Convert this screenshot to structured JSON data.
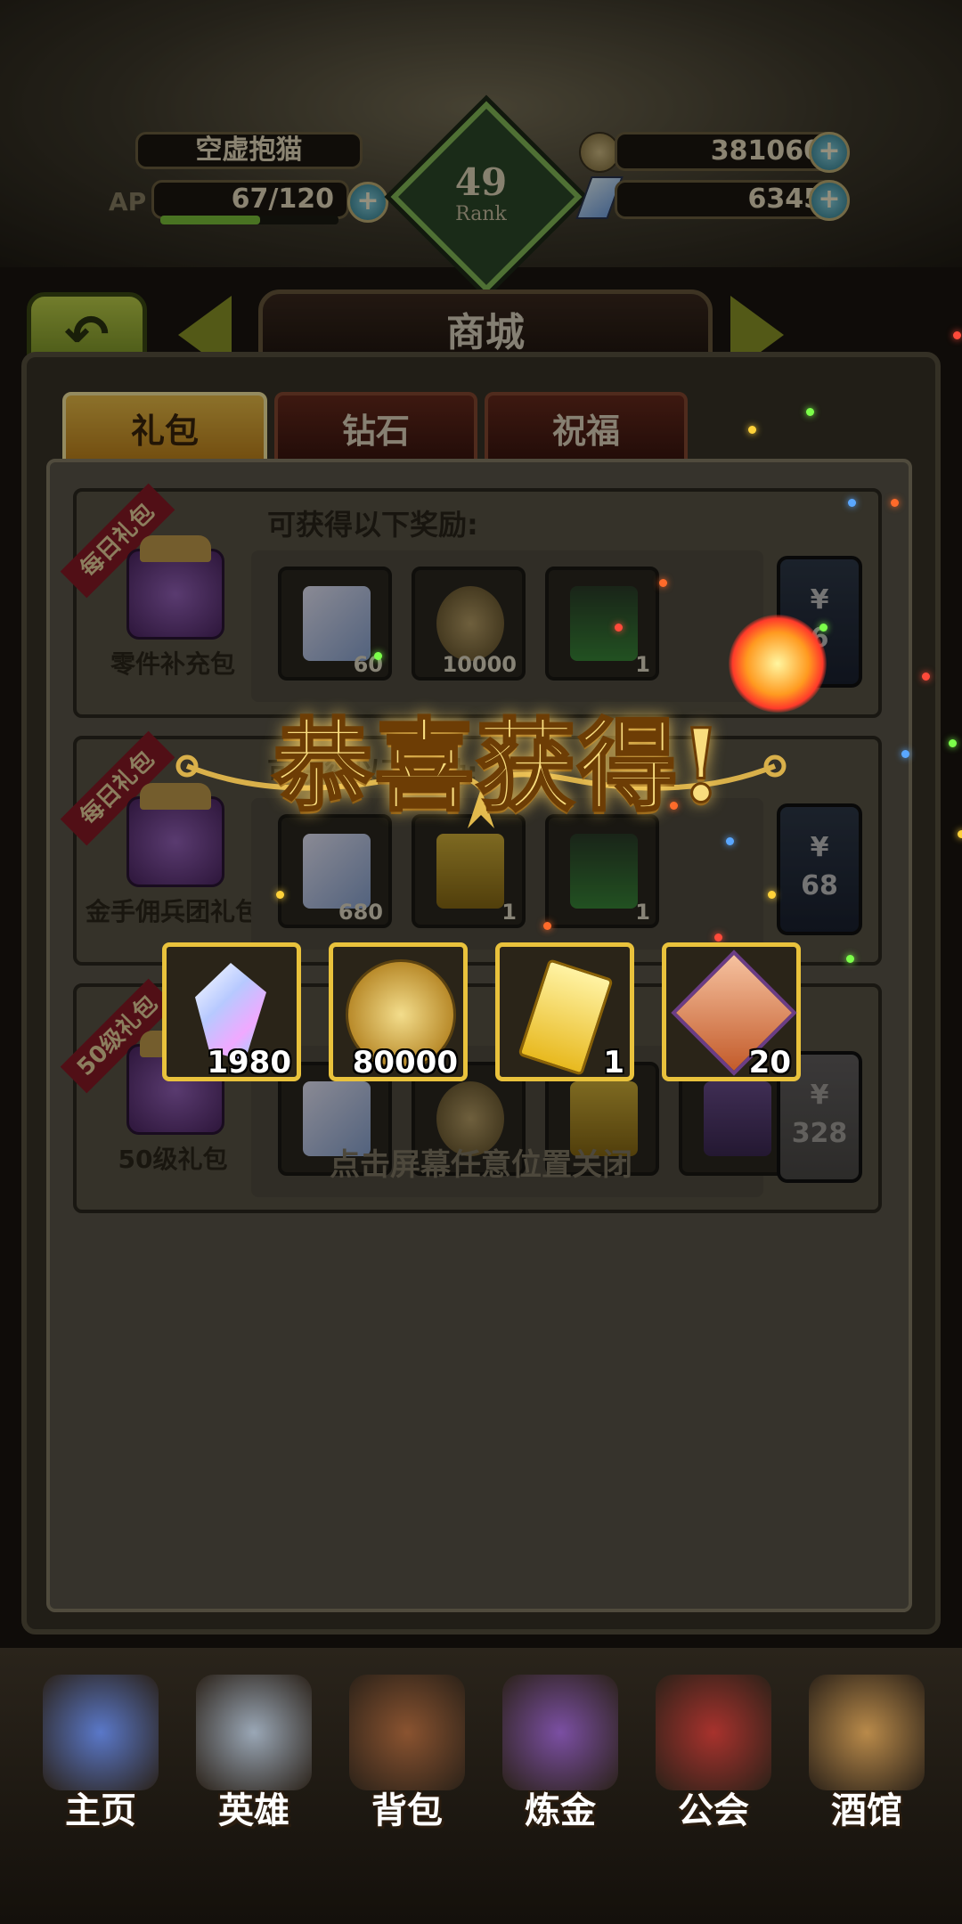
{
  "header": {
    "player_name": "空虚抱猫",
    "ap_label": "AP",
    "ap_value": "67/120",
    "ap_fill": 0.56,
    "rank_number": "49",
    "rank_label": "Rank",
    "gold": "381060",
    "gems": "6345",
    "plus": "+"
  },
  "title_bar": {
    "back_icon": "return-arrow-icon",
    "title": "商城"
  },
  "tabs": [
    {
      "label": "礼包",
      "active": true
    },
    {
      "label": "钻石",
      "active": false
    },
    {
      "label": "祝福",
      "active": false
    }
  ],
  "rewards_heading": "可获得以下奖励:",
  "packages": [
    {
      "ribbon": "每日礼包",
      "name": "零件补充包",
      "items": [
        {
          "icon": "crystal-icon",
          "count": "60"
        },
        {
          "icon": "gold-coin-icon",
          "count": "10000"
        },
        {
          "icon": "potion-vial-icon",
          "count": "1"
        }
      ],
      "price_symbol": "¥",
      "price": "6"
    },
    {
      "ribbon": "每日礼包",
      "name": "金手佣兵团礼包",
      "items": [
        {
          "icon": "crystal-icon",
          "count": "680"
        },
        {
          "icon": "ticket-icon",
          "count": "1"
        },
        {
          "icon": "potion-vial-icon",
          "count": "1"
        }
      ],
      "price_symbol": "¥",
      "price": "68"
    },
    {
      "ribbon": "50级礼包",
      "name": "50级礼包",
      "items": [
        {
          "icon": "crystal-icon",
          "count": ""
        },
        {
          "icon": "gold-coin-icon",
          "count": ""
        },
        {
          "icon": "ticket-icon",
          "count": ""
        },
        {
          "icon": "ur-card-icon",
          "count": ""
        }
      ],
      "price_symbol": "¥",
      "price": "328"
    }
  ],
  "popup": {
    "title": "恭喜获得!",
    "rewards": [
      {
        "icon": "crystal-icon",
        "count": "1980"
      },
      {
        "icon": "gold-coin-icon",
        "count": "80000"
      },
      {
        "icon": "ticket-icon",
        "count": "1"
      },
      {
        "icon": "emblem-icon",
        "count": "20"
      }
    ],
    "hint": "点击屏幕任意位置关闭"
  },
  "nav": [
    {
      "label": "主页",
      "icon": "castle-icon"
    },
    {
      "label": "英雄",
      "icon": "knight-helmet-icon"
    },
    {
      "label": "背包",
      "icon": "backpack-icon"
    },
    {
      "label": "炼金",
      "icon": "alchemy-flask-icon"
    },
    {
      "label": "公会",
      "icon": "guild-shield-icon"
    },
    {
      "label": "酒馆",
      "icon": "tavern-icon"
    }
  ],
  "colors": {
    "accent_gold": "#e9c23c",
    "tab_active": "#f1c34a",
    "ribbon_red": "#8c1a26"
  }
}
